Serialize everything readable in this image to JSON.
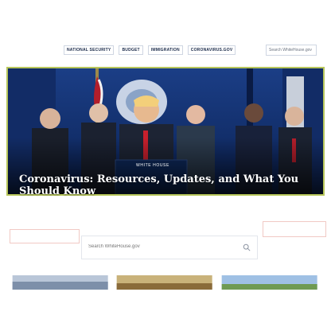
{
  "nav": {
    "links": [
      "National Security",
      "Budget",
      "Immigration",
      "Coronavirus.gov"
    ],
    "search_placeholder": "Search WhiteHouse.gov"
  },
  "hero": {
    "podium_text": "White House",
    "headline": "Coronavirus: Resources, Updates, and What You Should Know"
  },
  "search": {
    "placeholder": "Search WhiteHouse.gov"
  },
  "colors": {
    "navy": "#0e2a5e",
    "hero_border": "#b7c65a"
  },
  "icons": [
    "search-icon"
  ]
}
